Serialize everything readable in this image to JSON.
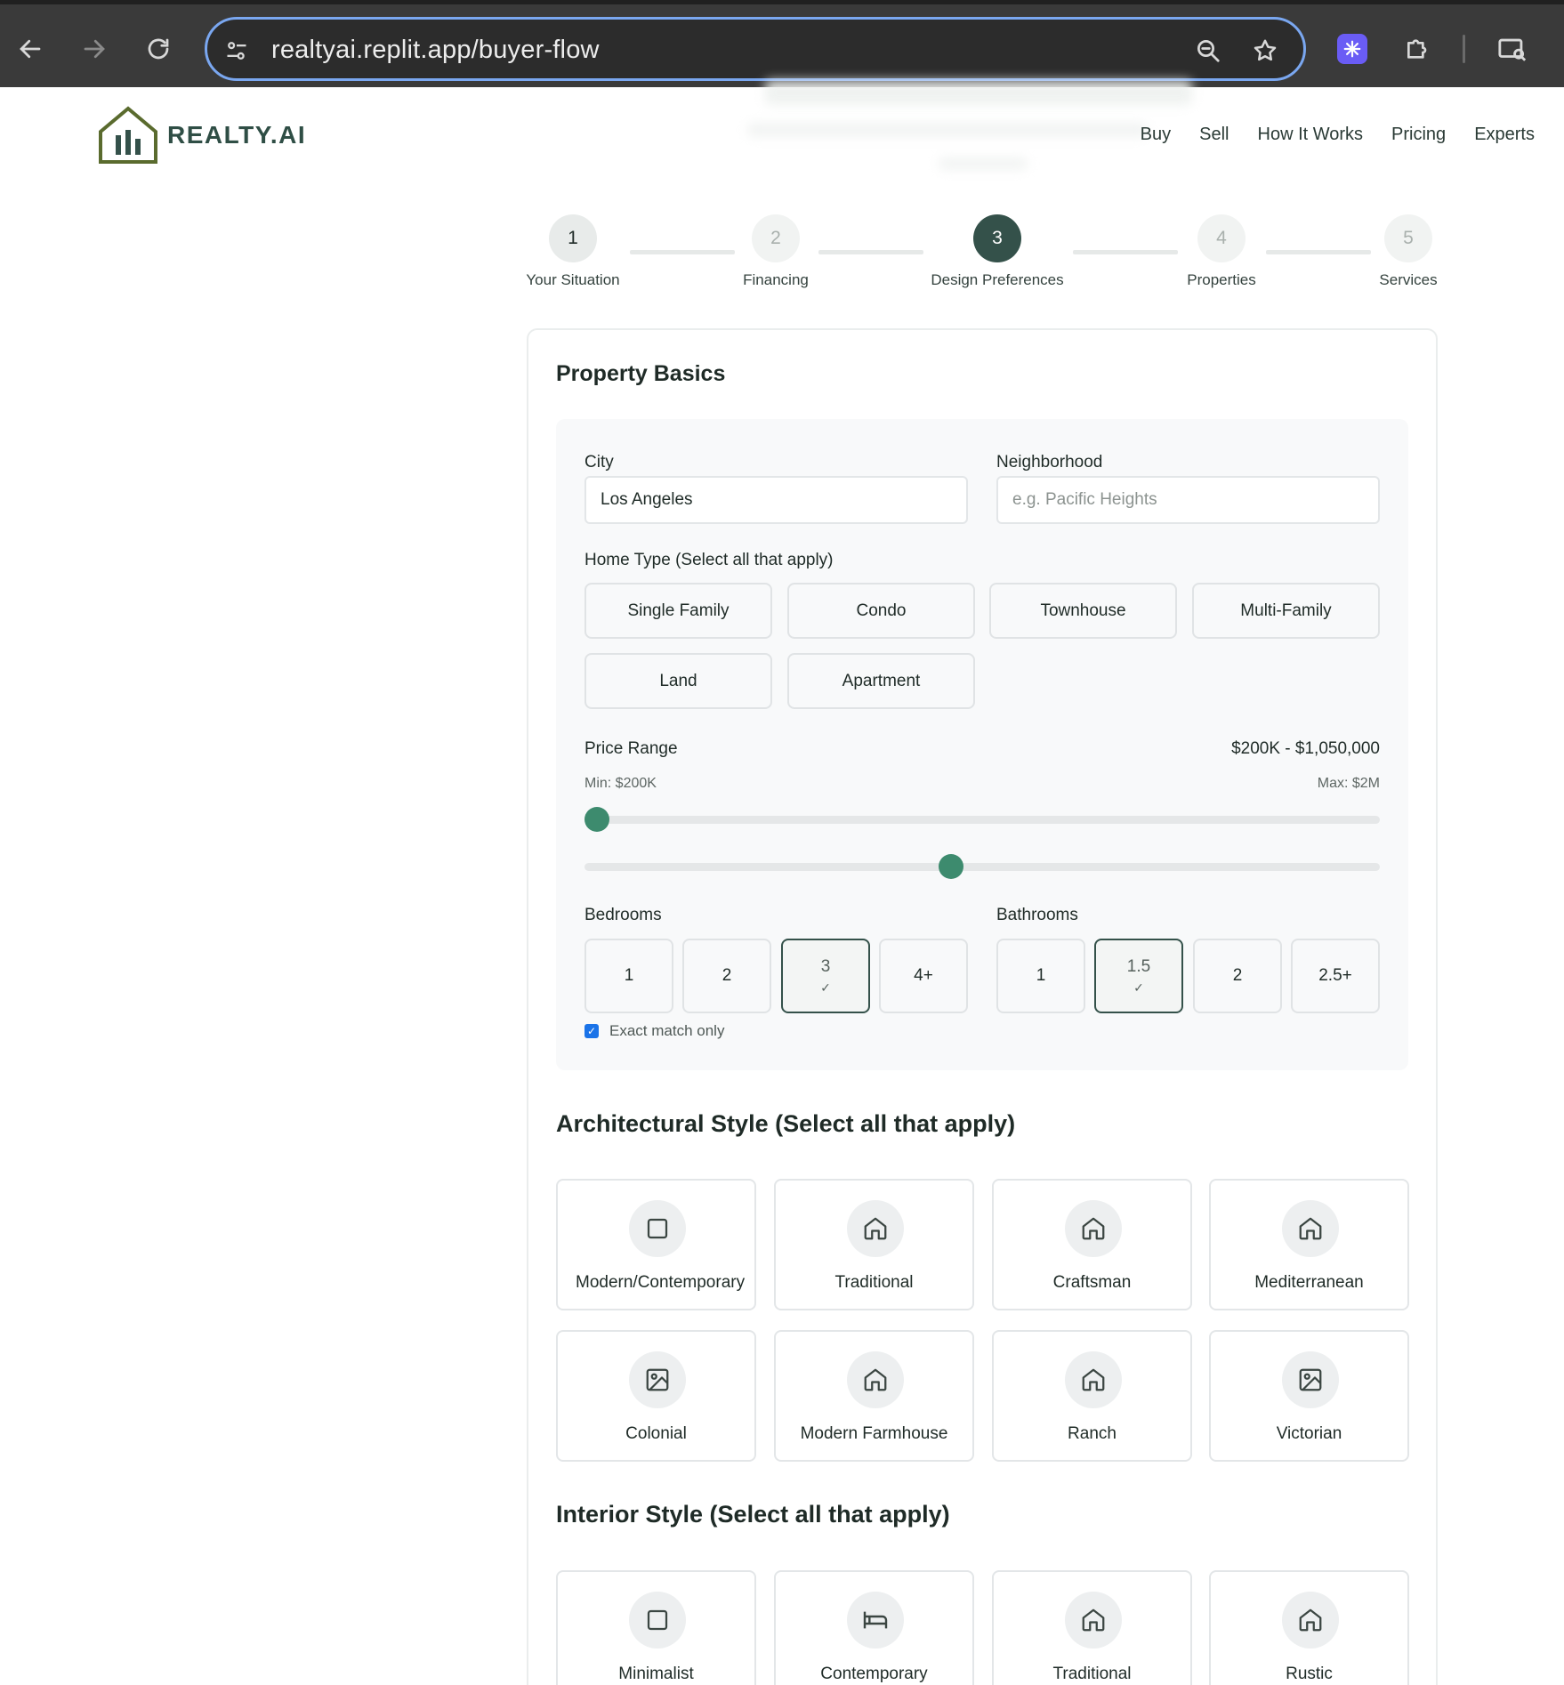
{
  "browser": {
    "url": "realtyai.replit.app/buyer-flow",
    "nav_icons": [
      "back-arrow-icon",
      "forward-arrow-icon",
      "reload-icon"
    ],
    "url_icons": [
      "site-settings-icon",
      "zoom-icon",
      "bookmark-star-icon"
    ],
    "toolbar_icons": [
      "extension-sparkle-icon",
      "extensions-puzzle-icon",
      "screen-search-icon"
    ]
  },
  "site": {
    "logo_text": "REALTY.AI",
    "nav": [
      "Buy",
      "Sell",
      "How It Works",
      "Pricing",
      "Experts"
    ]
  },
  "stepper": {
    "current": 3,
    "steps": [
      {
        "number": "1",
        "label": "Your Situation",
        "state": "done"
      },
      {
        "number": "2",
        "label": "Financing",
        "state": "todo"
      },
      {
        "number": "3",
        "label": "Design Preferences",
        "state": "active"
      },
      {
        "number": "4",
        "label": "Properties",
        "state": "todo"
      },
      {
        "number": "5",
        "label": "Services",
        "state": "todo"
      }
    ]
  },
  "basics": {
    "title": "Property Basics",
    "city_label": "City",
    "city_value": "Los Angeles",
    "neighborhood_label": "Neighborhood",
    "neighborhood_placeholder": "e.g. Pacific Heights",
    "home_type_label": "Home Type (Select all that apply)",
    "home_types": [
      "Single Family",
      "Condo",
      "Townhouse",
      "Multi-Family",
      "Land",
      "Apartment"
    ],
    "price_label": "Price Range",
    "price_value": "$200K - $1,050,000",
    "price_min_label": "Min: $200K",
    "price_max_label": "Max: $2M",
    "price_min_fraction": 0.0,
    "price_max_fraction": 0.46,
    "bedrooms_label": "Bedrooms",
    "bedrooms": [
      "1",
      "2",
      "3",
      "4+"
    ],
    "bedrooms_selected": "3",
    "bathrooms_label": "Bathrooms",
    "bathrooms": [
      "1",
      "1.5",
      "2",
      "2.5+"
    ],
    "bathrooms_selected": "1.5",
    "exact_match_label": "Exact match only",
    "exact_match_checked": true
  },
  "architectural": {
    "title": "Architectural Style (Select all that apply)",
    "styles": [
      {
        "label": "Modern/Contemporary",
        "icon": "square-icon"
      },
      {
        "label": "Traditional",
        "icon": "house-icon"
      },
      {
        "label": "Craftsman",
        "icon": "house-icon"
      },
      {
        "label": "Mediterranean",
        "icon": "house-icon"
      },
      {
        "label": "Colonial",
        "icon": "image-icon"
      },
      {
        "label": "Modern Farmhouse",
        "icon": "house-icon"
      },
      {
        "label": "Ranch",
        "icon": "house-icon"
      },
      {
        "label": "Victorian",
        "icon": "image-icon"
      }
    ]
  },
  "interior": {
    "title": "Interior Style (Select all that apply)",
    "styles": [
      {
        "label": "Minimalist",
        "icon": "square-icon"
      },
      {
        "label": "Contemporary",
        "icon": "bed-icon"
      },
      {
        "label": "Traditional",
        "icon": "house-icon"
      },
      {
        "label": "Rustic",
        "icon": "house-icon"
      }
    ]
  },
  "colors": {
    "accent": "#3d8b6e",
    "primary_dark": "#34514a",
    "logo_olive": "#5a6b2e"
  }
}
